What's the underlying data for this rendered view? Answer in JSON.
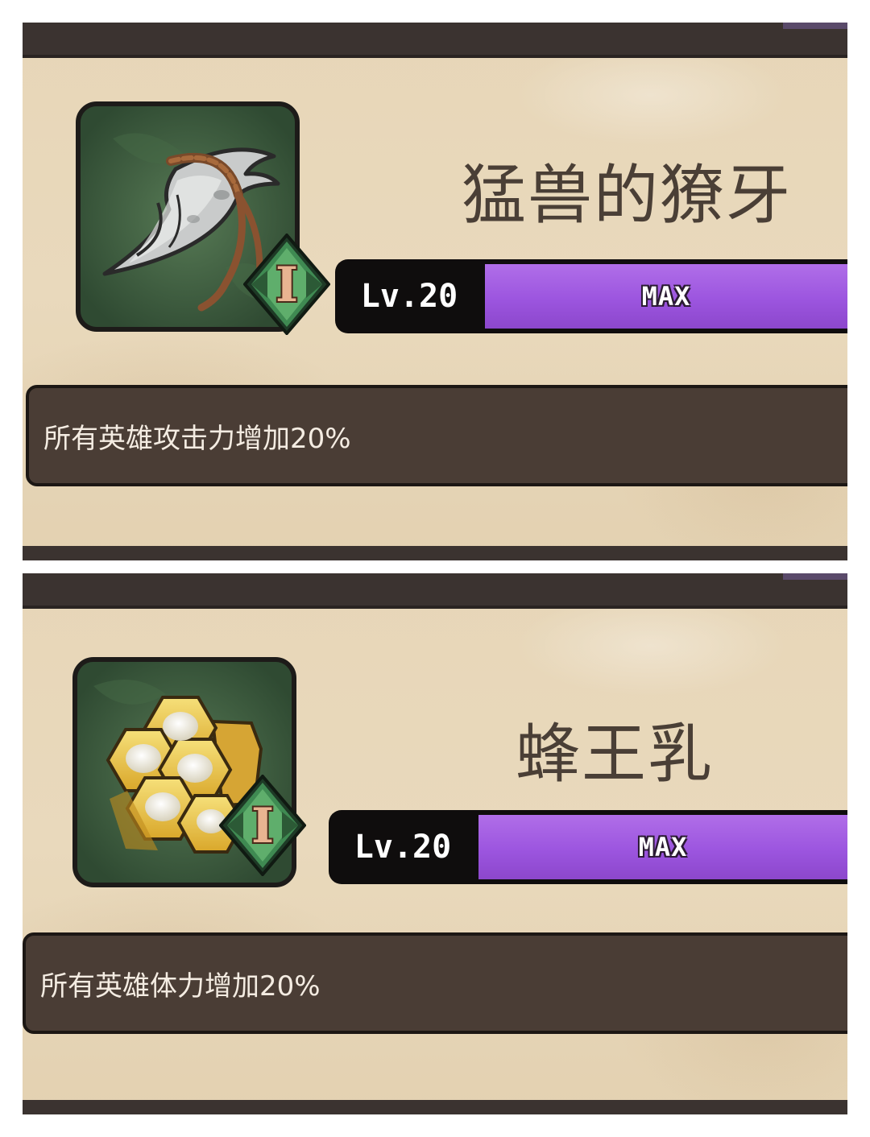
{
  "items": [
    {
      "name": "猛兽的獠牙",
      "icon": "fang-icon",
      "rank": "I",
      "level_label": "Lv.20",
      "level_status": "MAX",
      "level_progress": 1.0,
      "description": "所有英雄攻击力增加20%"
    },
    {
      "name": "蜂王乳",
      "icon": "honeycomb-icon",
      "rank": "I",
      "level_label": "Lv.20",
      "level_status": "MAX",
      "level_progress": 1.0,
      "description": "所有英雄体力增加20%"
    }
  ],
  "colors": {
    "parchment": "#e7d6b8",
    "level_fill": "#9c55df",
    "description_bg": "#4a3d35",
    "frame": "#1d1b19"
  }
}
